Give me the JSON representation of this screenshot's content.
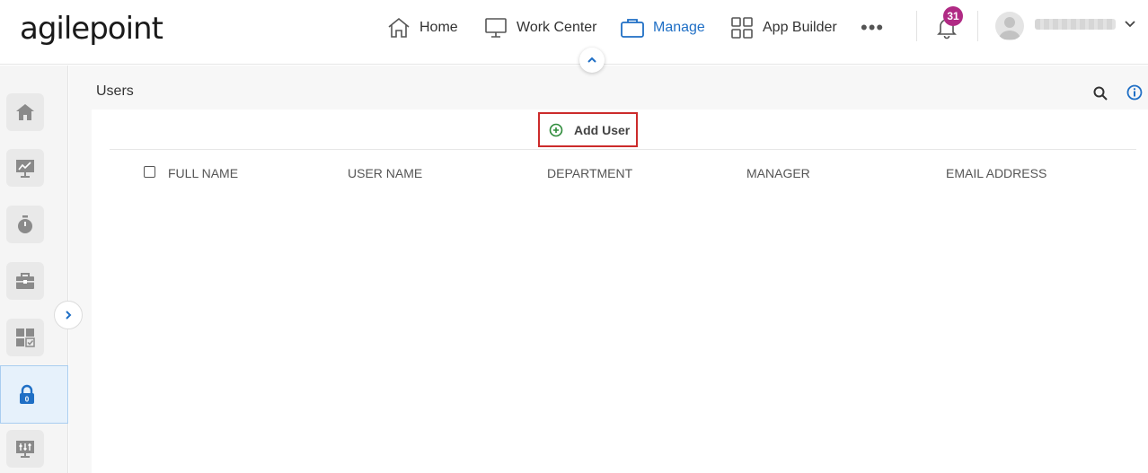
{
  "header": {
    "logo": "agilepoint",
    "nav": [
      {
        "label": "Home",
        "icon": "home-icon"
      },
      {
        "label": "Work Center",
        "icon": "monitor-icon"
      },
      {
        "label": "Manage",
        "icon": "briefcase-icon",
        "active": true
      },
      {
        "label": "App Builder",
        "icon": "grid-icon"
      }
    ],
    "more": "•••",
    "notifications_count": "31"
  },
  "sidebar": {
    "items": [
      {
        "name": "home-icon"
      },
      {
        "name": "chart-icon"
      },
      {
        "name": "timer-icon"
      },
      {
        "name": "toolbox-icon"
      },
      {
        "name": "apps-check-icon"
      },
      {
        "name": "lock-icon",
        "active": true,
        "badge": "0"
      },
      {
        "name": "settings-monitor-icon"
      }
    ]
  },
  "main": {
    "title": "Users",
    "add_user_label": "Add User",
    "columns": [
      "FULL NAME",
      "USER NAME",
      "DEPARTMENT",
      "MANAGER",
      "EMAIL ADDRESS"
    ]
  },
  "colors": {
    "accent": "#1f6fc5",
    "badge": "#b02a84",
    "add_icon": "#2e8b3a",
    "highlight_box": "#cc2b2b"
  }
}
